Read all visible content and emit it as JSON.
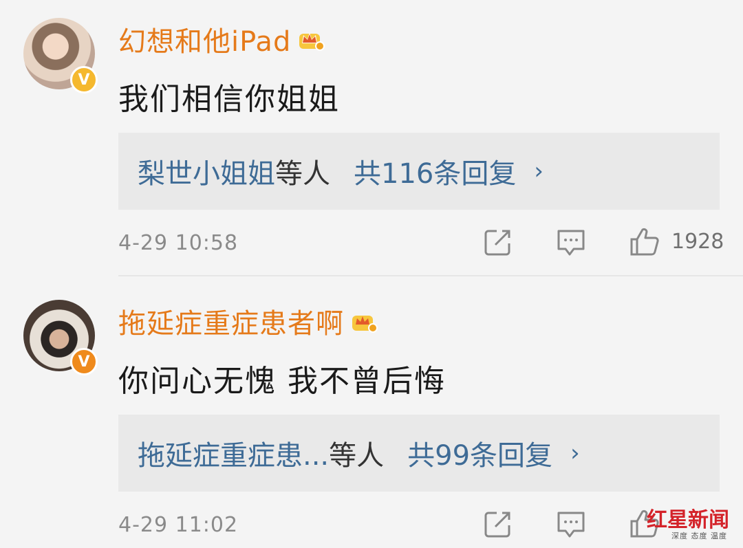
{
  "comments": [
    {
      "username": "幻想和他iPad",
      "text": "我们相信你姐姐",
      "reply_name": "梨世小姐姐",
      "reply_mid": "等人",
      "reply_count": "共116条回复",
      "reply_chevron": "›",
      "time": "4-29 10:58",
      "likes": "1928",
      "badge": "V"
    },
    {
      "username": "拖延症重症患者啊",
      "text": "你问心无愧 我不曾后悔",
      "reply_name": "拖延症重症患...",
      "reply_mid": "等人",
      "reply_count": "共99条回复",
      "reply_chevron": "›",
      "time": "4-29 11:02",
      "likes": "",
      "badge": "V"
    }
  ],
  "watermark": {
    "main": "红星新闻",
    "sub": "深度 态度 温度"
  },
  "colors": {
    "username": "#e57a1a",
    "link": "#3e6b96",
    "watermark": "#d4232a"
  }
}
